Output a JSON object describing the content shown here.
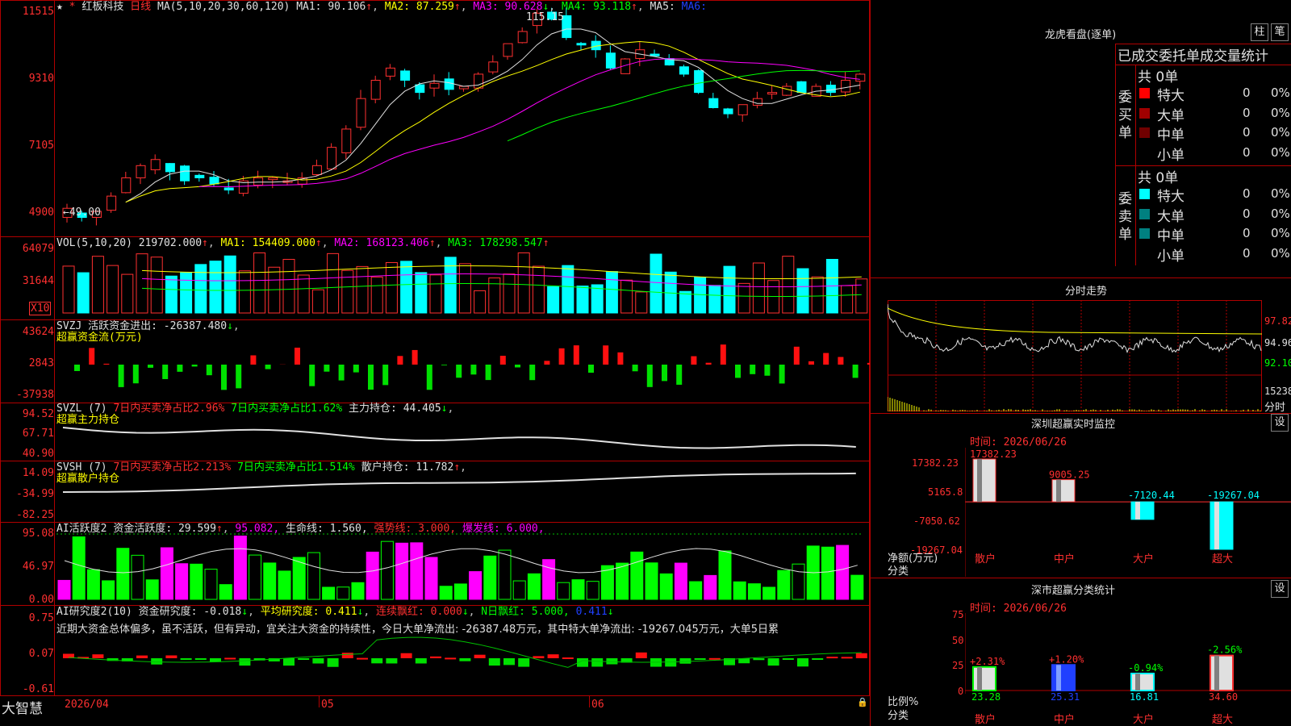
{
  "header": {
    "stock_name": "红板科技",
    "period": "日线",
    "ma_params": "MA(5,10,20,30,60,120)",
    "ma1": "MA1: 90.106",
    "ma2": "MA2: 87.259",
    "ma3": "MA3: 90.628",
    "ma4": "MA4: 93.118",
    "ma5": "MA5:",
    "ma6": "MA6:",
    "high_label": "115.15",
    "low_label": "←49.00"
  },
  "price_axis": [
    "11515",
    "9310",
    "7105",
    "4900"
  ],
  "vol_panel": {
    "title": "VOL(5,10,20)",
    "value": "219702.000",
    "ma1": "MA1: 154409.000",
    "ma2": "MA2: 168123.406",
    "ma3": "MA3: 178298.547",
    "axis": [
      "64079",
      "31644"
    ],
    "unit": "X10"
  },
  "svzj_panel": {
    "title": "SVZJ",
    "line1": "活跃资金进出: -26387.480",
    "line2": "超赢资金流(万元)",
    "axis": [
      "43624",
      "2843",
      "-37938"
    ]
  },
  "svzl_panel": {
    "title": "SVZL (7)",
    "p1": "7日内买卖净占比2.96%",
    "p2": "7日内买卖净占比1.62%",
    "p3": "主力持仓: 44.405",
    "line2": "超赢主力持仓",
    "axis": [
      "94.52",
      "67.71",
      "40.90"
    ]
  },
  "svsh_panel": {
    "title": "SVSH (7)",
    "p1": "7日内买卖净占比2.213%",
    "p2": "7日内买卖净占比1.514%",
    "p3": "散户持仓: 11.782",
    "line2": "超赢散户持仓",
    "axis": [
      "14.09",
      "-34.99",
      "-82.25"
    ]
  },
  "ai_active_panel": {
    "title": "AI活跃度2",
    "p1": "资金活跃度: 29.599",
    "p2": "95.082,",
    "p3": "生命线: 1.560,",
    "p4": "强势线: 3.000,",
    "p5": "爆发线: 6.000,",
    "axis": [
      "95.08",
      "46.97",
      "0.00"
    ]
  },
  "ai_research_panel": {
    "title": "AI研究度2(10)",
    "p1": "资金研究度: -0.018",
    "p2": "平均研究度: 0.411",
    "p3": "连续飘红: 0.000",
    "p4": "N日飘红: 5.000,",
    "p5": "0.411",
    "comment": "近期大资金总体偏多，虽不活跃，但有异动，宜关注大资金的持续性，今日大单净流出: -26387.48万元，其中特大单净流出: -19267.045万元，大单5日累",
    "axis": [
      "0.75",
      "0.07",
      "-0.61"
    ]
  },
  "bottom_bar": {
    "brand": "大智慧",
    "dates": [
      "2026/04",
      "05",
      "06"
    ]
  },
  "dragon_tiger": {
    "title": "龙虎看盘(逐单)",
    "btn_bar": "柱",
    "btn_pen": "笔",
    "tabs": "已成交委托单成交量统计",
    "buy_side": "委买单",
    "sell_side": "委卖单",
    "buy_total": "共 0单",
    "sell_total": "共 0单",
    "buy_rows": [
      {
        "label": "特大",
        "count": "0",
        "pct": "0%",
        "color": "#ff0000"
      },
      {
        "label": "大单",
        "count": "0",
        "pct": "0%",
        "color": "#a00000"
      },
      {
        "label": "中单",
        "count": "0",
        "pct": "0%",
        "color": "#700000"
      },
      {
        "label": "小单",
        "count": "0",
        "pct": "0%",
        "color": ""
      }
    ],
    "sell_rows": [
      {
        "label": "特大",
        "count": "0",
        "pct": "0%",
        "color": "#00ffff"
      },
      {
        "label": "大单",
        "count": "0",
        "pct": "0%",
        "color": "#008080"
      },
      {
        "label": "中单",
        "count": "0",
        "pct": "0%",
        "color": "#008080"
      },
      {
        "label": "小单",
        "count": "0",
        "pct": "0%",
        "color": ""
      }
    ]
  },
  "intraday": {
    "title": "分时走势",
    "axis": [
      "97.82",
      "94.96",
      "92.10",
      "15238",
      "分时"
    ]
  },
  "sz_monitor": {
    "title": "深圳超赢实时监控",
    "btn": "设",
    "time": "时间: 2026/06/26",
    "axis": [
      "17382.23",
      "5165.8",
      "-7050.62",
      "-19267.04"
    ],
    "ylabel": "净额(万元)",
    "xlabel": "分类",
    "chart_data": {
      "type": "bar",
      "categories": [
        "散户",
        "中户",
        "大户",
        "超大"
      ],
      "values": [
        17382.23,
        9005.25,
        -7120.44,
        -19267.04
      ],
      "labels": [
        "17382.23",
        "9005.25",
        "-7120.44",
        "-19267.04"
      ],
      "ylim": [
        -19267.04,
        17382.23
      ]
    }
  },
  "sz_category": {
    "title": "深市超赢分类统计",
    "btn": "设",
    "time": "时间: 2026/06/26",
    "axis": [
      "75",
      "50",
      "25",
      "0"
    ],
    "ylabel": "比例%",
    "xlabel": "分类",
    "chart_data": {
      "type": "bar",
      "categories": [
        "散户",
        "中户",
        "大户",
        "超大"
      ],
      "values": [
        23.28,
        25.31,
        16.81,
        34.6
      ],
      "value_labels": [
        "23.28",
        "25.31",
        "16.81",
        "34.60"
      ],
      "changes": [
        "+2.31%",
        "+1.20%",
        "-0.94%",
        "-2.56%"
      ],
      "ylim": [
        0,
        75
      ]
    }
  }
}
